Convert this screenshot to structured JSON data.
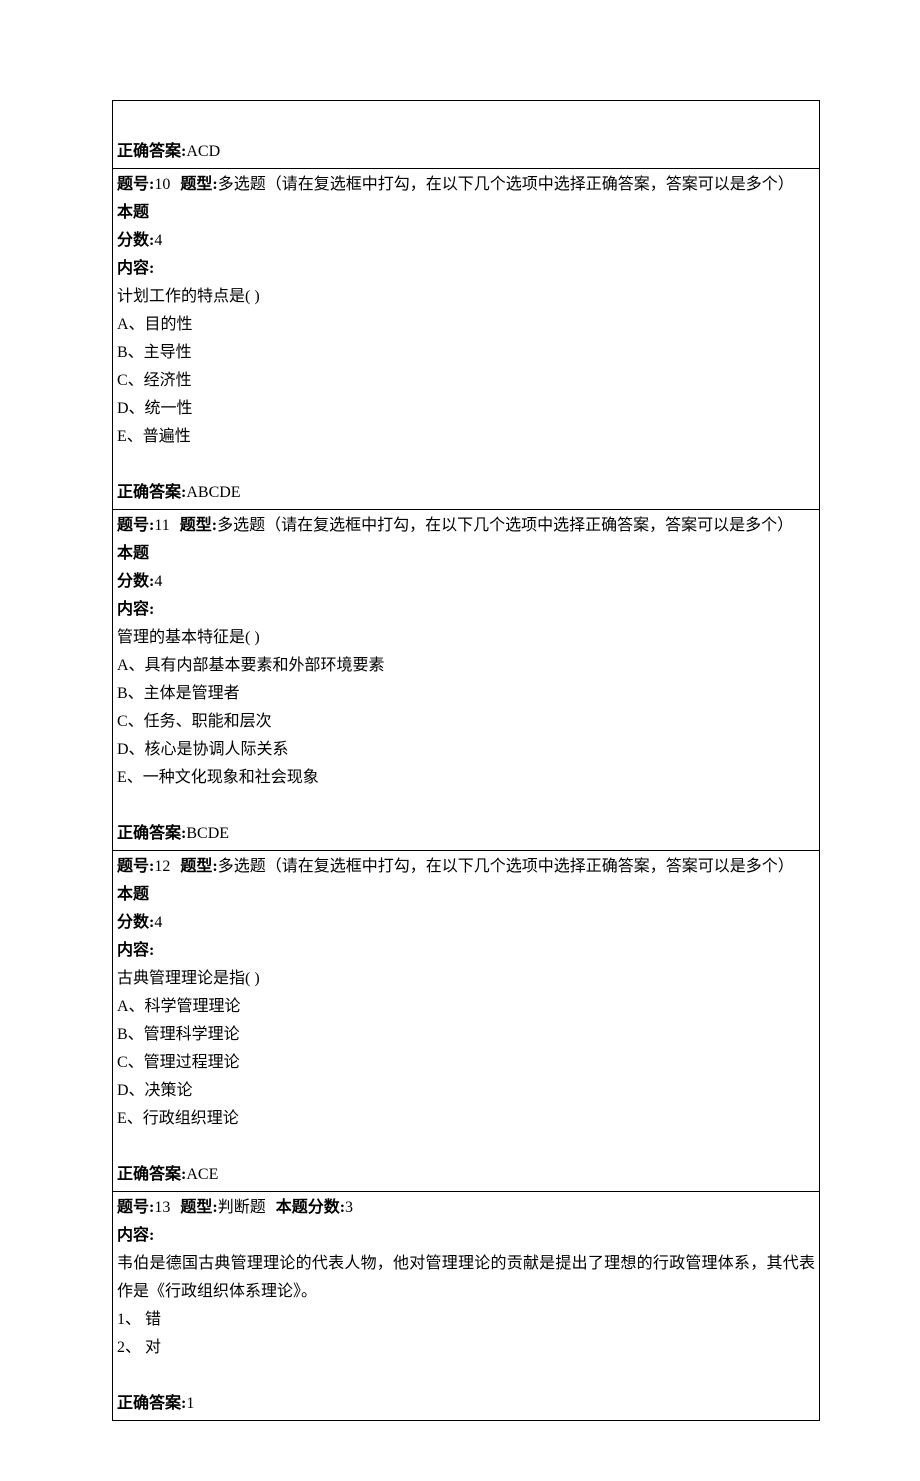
{
  "labels": {
    "answer_prefix": "正确答案:",
    "question_num_prefix": "题号:",
    "question_type_prefix": "题型:",
    "points_prefix_inline": "本题",
    "points_prefix": "本题分数:",
    "points_label_line2": "分数:",
    "content_label": "内容:"
  },
  "q9": {
    "answer": "ACD"
  },
  "q10": {
    "num": "10",
    "type": "多选题（请在复选框中打勾，在以下几个选项中选择正确答案，答案可以是多个）",
    "points": "4",
    "question": "计划工作的特点是( )",
    "options": {
      "a": "A、目的性",
      "b": "B、主导性",
      "c": "C、经济性",
      "d": "D、统一性",
      "e": "E、普遍性"
    },
    "answer": "ABCDE"
  },
  "q11": {
    "num": "11",
    "type": "多选题（请在复选框中打勾，在以下几个选项中选择正确答案，答案可以是多个）",
    "points": "4",
    "question": "管理的基本特征是( )",
    "options": {
      "a": "A、具有内部基本要素和外部环境要素",
      "b": "B、主体是管理者",
      "c": "C、任务、职能和层次",
      "d": "D、核心是协调人际关系",
      "e": "E、一种文化现象和社会现象"
    },
    "answer": "BCDE"
  },
  "q12": {
    "num": "12",
    "type": "多选题（请在复选框中打勾，在以下几个选项中选择正确答案，答案可以是多个）",
    "points": "4",
    "question": "古典管理理论是指( )",
    "options": {
      "a": "A、科学管理理论",
      "b": "B、管理科学理论",
      "c": "C、管理过程理论",
      "d": "D、决策论",
      "e": "E、行政组织理论"
    },
    "answer": "ACE"
  },
  "q13": {
    "num": "13",
    "type": "判断题",
    "points": "3",
    "question": "韦伯是德国古典管理理论的代表人物，他对管理理论的贡献是提出了理想的行政管理体系，其代表作是《行政组织体系理论》。",
    "options": {
      "a": "1、  错",
      "b": "2、  对"
    },
    "answer": "1"
  }
}
